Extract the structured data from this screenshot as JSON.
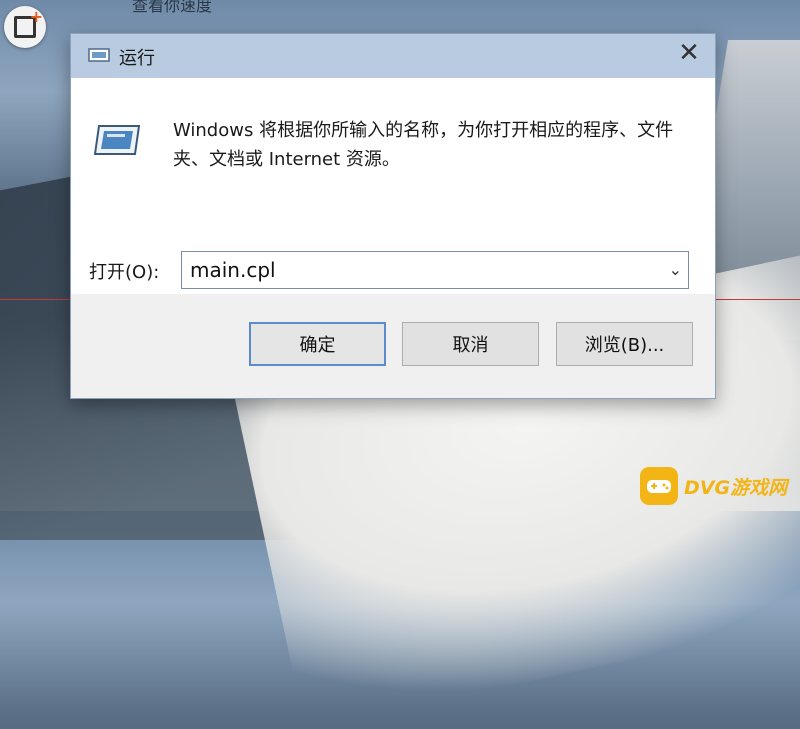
{
  "background": {
    "top_text": "查看你速度"
  },
  "dialog": {
    "title": "运行",
    "description": "Windows 将根据你所输入的名称，为你打开相应的程序、文件夹、文档或 Internet 资源。",
    "open_label": "打开(O):",
    "input_value": "main.cpl",
    "buttons": {
      "ok": "确定",
      "cancel": "取消",
      "browse": "浏览(B)..."
    }
  },
  "watermark": {
    "brand": "DVG游戏网"
  },
  "colors": {
    "titlebar": "#b9cbe0",
    "default_button_border": "#5a8ccb",
    "watermark": "#f3b515",
    "redline": "#c43a3a"
  },
  "icons": [
    "app-corner-icon",
    "run-title-icon",
    "close-icon",
    "run-program-icon",
    "chevron-down-icon",
    "gamepad-icon"
  ]
}
